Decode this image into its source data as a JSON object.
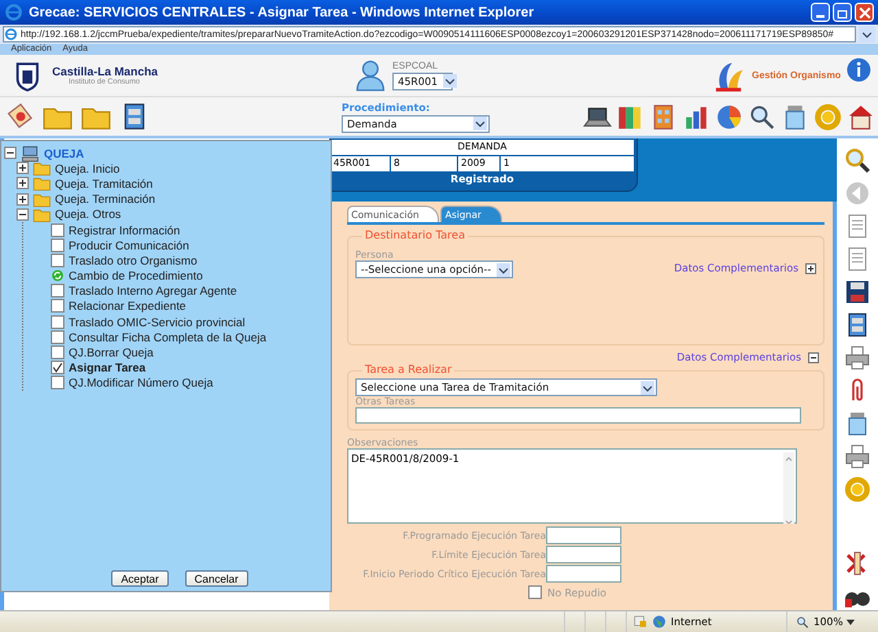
{
  "window": {
    "title": "Grecae: SERVICIOS CENTRALES - Asignar Tarea - Windows Internet Explorer"
  },
  "address_bar": {
    "url": "http://192.168.1.2/jccmPrueba/expediente/tramites/prepararNuevoTramiteAction.do?ezcodigo=W0090514111606ESP0008ezcoy1=200603291201ESP371428nodo=200611171719ESP89850#"
  },
  "menu_bar": [
    "Aplicación",
    "Ayuda"
  ],
  "header": {
    "org_name": "Castilla-La Mancha",
    "org_subtitle": "Instituto de Consumo",
    "user": "ESPCOAL",
    "office": "45R001",
    "module": "Gestión Organismo"
  },
  "toolbar": {
    "procedure_label": "Procedimiento:",
    "procedure": "Demanda"
  },
  "tree": {
    "label": "QUEJA",
    "expanded": true,
    "children": [
      {
        "label": "Queja. Inicio",
        "expanded": false
      },
      {
        "label": "Queja. Tramitación",
        "expanded": false
      },
      {
        "label": "Queja. Terminación",
        "expanded": false
      },
      {
        "label": "Queja. Otros",
        "expanded": true,
        "children": [
          {
            "label": "Registrar Información",
            "kind": "checkbox",
            "checked": false
          },
          {
            "label": "Producir Comunicación",
            "kind": "checkbox",
            "checked": false
          },
          {
            "label": "Traslado otro Organismo",
            "kind": "checkbox",
            "checked": false
          },
          {
            "label": "Cambio de Procedimiento",
            "kind": "status"
          },
          {
            "label": "Traslado Interno Agregar Agente",
            "kind": "checkbox",
            "checked": false
          },
          {
            "label": "Relacionar Expediente",
            "kind": "checkbox",
            "checked": false
          },
          {
            "label": "Traslado OMIC-Servicio provincial",
            "kind": "checkbox",
            "checked": false
          },
          {
            "label": "Consultar Ficha Completa de la Queja",
            "kind": "checkbox",
            "checked": false
          },
          {
            "label": "QJ.Borrar Queja",
            "kind": "checkbox",
            "checked": false
          },
          {
            "label": "Asignar Tarea",
            "kind": "checkbox",
            "checked": true
          },
          {
            "label": "QJ.Modificar Número Queja",
            "kind": "checkbox",
            "checked": false
          }
        ]
      }
    ]
  },
  "tree_buttons": [
    "Aceptar",
    "Cancelar"
  ],
  "record": {
    "title": "DEMANDA",
    "fields": [
      "45R001",
      "8",
      "2009",
      "1"
    ],
    "status": "Registrado"
  },
  "tabs": [
    {
      "label": "Comunicación",
      "selected": false
    },
    {
      "label": "Asignar",
      "selected": true
    }
  ],
  "recipient": {
    "legend": "Destinatario Tarea",
    "person_label": "Persona",
    "person": "--Seleccione una opción--",
    "link": "Datos Complementarios",
    "expanded": false
  },
  "extra_link": {
    "label": "Datos Complementarios",
    "expanded": true
  },
  "task": {
    "legend": "Tarea a Realizar",
    "task": "Seleccione una Tarea de Tramitación",
    "other_label": "Otras Tareas"
  },
  "observations": {
    "label": "Observaciones",
    "value": "DE-45R001/8/2009-1"
  },
  "dates": [
    {
      "label": "F.Programado Ejecución Tarea"
    },
    {
      "label": "F.Límite Ejecución Tarea"
    },
    {
      "label": "F.Inicio Periodo Crítico Ejecución Tarea"
    }
  ],
  "no_repudio": {
    "label": "No Repudio",
    "checked": false
  },
  "status_bar": {
    "zone": "Internet",
    "zoom": "100%"
  }
}
